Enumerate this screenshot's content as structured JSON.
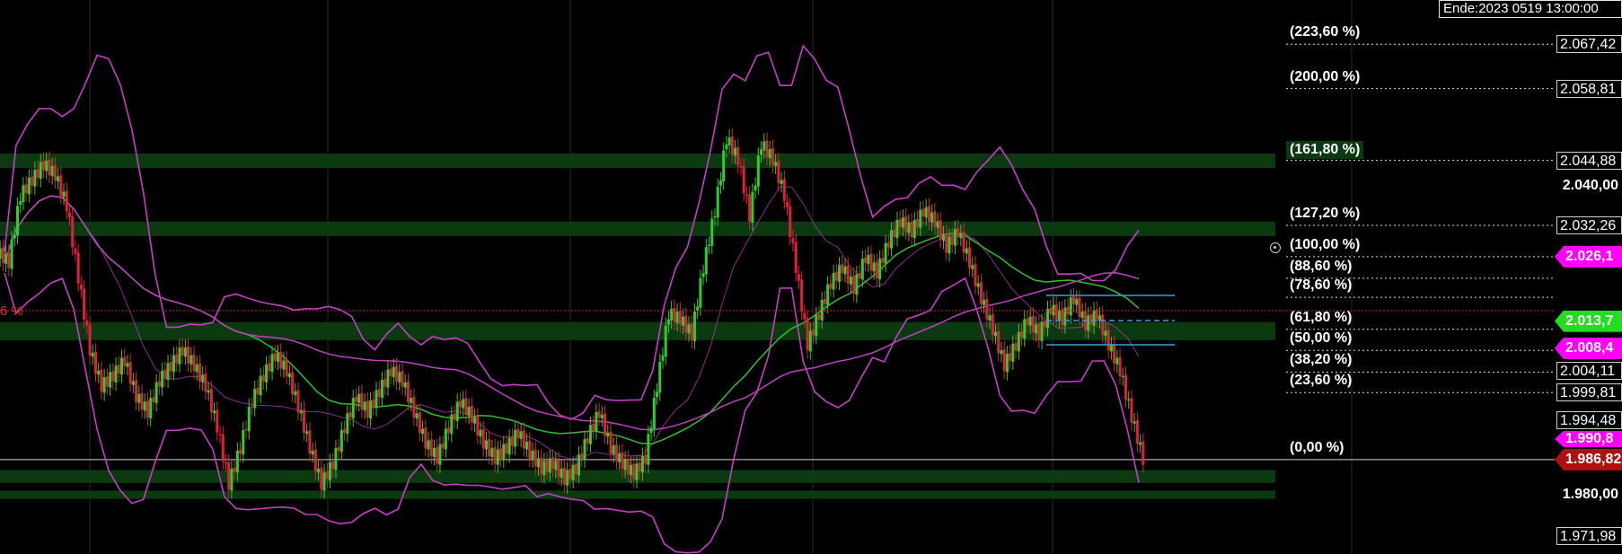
{
  "window": {
    "end_label": "Ende:2023 0519 13:00:00"
  },
  "colors": {
    "background": "#000000",
    "up_candle": "#2ecc2e",
    "down_candle": "#e0203a",
    "bollinger": "#c83cc8",
    "ma_green": "#2fbf2f",
    "ma_magenta": "#c040c0",
    "zone": "#0c3a10",
    "tag_magenta": "#ff00ff",
    "tag_green": "#22dd22",
    "tag_red": "#b01010",
    "fib_line": "#dddddd",
    "box_line": "#3ba0d8",
    "dotted_red": "#c02020"
  },
  "partial_left_label": "6 %",
  "chart_data": {
    "type": "candlestick",
    "title": "",
    "x_end": "2023 0519 13:00:00",
    "y_axis": {
      "range": [
        1.9685,
        2.076
      ],
      "ticks": [
        "2.067,42",
        "2.058,81",
        "2.044,88",
        "2.040,00",
        "2.032,26",
        "2.013,7",
        "2.004,11",
        "1.999,81",
        "1.994,48",
        "1.986,82",
        "1.980,00",
        "1.971,98"
      ]
    },
    "fibonacci_levels": [
      {
        "label": "(223,60 %)",
        "price": 2.06742,
        "price_label": "2.067,42"
      },
      {
        "label": "(200,00 %)",
        "price": 2.05881,
        "price_label": "2.058,81"
      },
      {
        "label": "(161,80 %)",
        "price": 2.04488,
        "price_label": "2.044,88",
        "highlight": true
      },
      {
        "label": "(127,20 %)",
        "price": 2.03226,
        "price_label": "2.032,26"
      },
      {
        "label": "(100,00 %)",
        "price": 2.0262
      },
      {
        "label": "(88,60 %)",
        "price": 2.022
      },
      {
        "label": "(78,60 %)",
        "price": 2.0183
      },
      {
        "label": "(61,80 %)",
        "price": 2.0121
      },
      {
        "label": "(50,00 %)",
        "price": 2.008
      },
      {
        "label": "(38,20 %)",
        "price": 2.0038,
        "price_label": "2.004,11"
      },
      {
        "label": "(23,60 %)",
        "price": 1.99981,
        "price_label": "1.999,81"
      },
      {
        "label": "(0,00 %)",
        "price": 1.98682
      }
    ],
    "axis_labels_plain": [
      {
        "text": "2.040,00",
        "price": 2.04
      },
      {
        "text": "1.980,00",
        "price": 1.98
      }
    ],
    "axis_labels_boxed": [
      {
        "text": "2.067,42",
        "price": 2.06742
      },
      {
        "text": "2.058,81",
        "price": 2.05881
      },
      {
        "text": "2.044,88",
        "price": 2.04488
      },
      {
        "text": "2.032,26",
        "price": 2.03226
      },
      {
        "text": "2.004,11",
        "price": 2.00411
      },
      {
        "text": "1.999,81",
        "price": 1.99981
      },
      {
        "text": "1.994,48",
        "price": 1.99448
      },
      {
        "text": "1.971,98",
        "price": 1.97198
      }
    ],
    "tags": [
      {
        "text": "2.026,1",
        "price": 2.0262,
        "color": "#ff00ff"
      },
      {
        "text": "2.013,7",
        "price": 2.0137,
        "color": "#22dd22"
      },
      {
        "text": "2.008,4",
        "price": 2.0084,
        "color": "#ff00ff"
      },
      {
        "text": "1.990,8",
        "price": 1.9908,
        "color": "#ff00ff",
        "small": true
      },
      {
        "text": "1.986,82",
        "price": 1.98682,
        "color": "#b01010"
      }
    ],
    "zones": [
      {
        "from": 2.0434,
        "to": 2.0462,
        "label": "zone-161"
      },
      {
        "from": 2.0302,
        "to": 2.033,
        "label": "zone-127"
      },
      {
        "from": 2.01,
        "to": 2.0135,
        "label": "zone-618"
      },
      {
        "from": 1.9823,
        "to": 1.9848,
        "label": "zone-low-1"
      },
      {
        "from": 1.9792,
        "to": 1.9808,
        "label": "zone-low-2"
      }
    ],
    "series": [
      {
        "kind": "close",
        "values": [
          2.025,
          2.038,
          2.041,
          2.044,
          2.042,
          2.036,
          2.022,
          2.008,
          2.001,
          2.003,
          2.006,
          1.999,
          1.996,
          2.002,
          2.005,
          2.008,
          2.005,
          2.001,
          1.993,
          1.982,
          1.989,
          1.998,
          2.003,
          2.007,
          2.004,
          1.997,
          1.989,
          1.982,
          1.986,
          1.993,
          1.999,
          1.996,
          2.0,
          2.004,
          2.002,
          1.996,
          1.99,
          1.987,
          1.993,
          1.998,
          1.995,
          1.99,
          1.987,
          1.989,
          1.992,
          1.988,
          1.985,
          1.986,
          1.983,
          1.985,
          1.991,
          1.996,
          1.989,
          1.986,
          1.984,
          1.987,
          2.001,
          2.015,
          2.014,
          2.011,
          2.024,
          2.035,
          2.049,
          2.045,
          2.034,
          2.048,
          2.045,
          2.038,
          2.024,
          2.009,
          2.015,
          2.021,
          2.024,
          2.02,
          2.026,
          2.023,
          2.029,
          2.033,
          2.031,
          2.035,
          2.033,
          2.028,
          2.031,
          2.025,
          2.018,
          2.012,
          2.005,
          2.009,
          2.014,
          2.011,
          2.016,
          2.014,
          2.018,
          2.013,
          2.015,
          2.009,
          2.004,
          1.995,
          1.9868
        ]
      }
    ],
    "grid": true,
    "legend": "none"
  }
}
